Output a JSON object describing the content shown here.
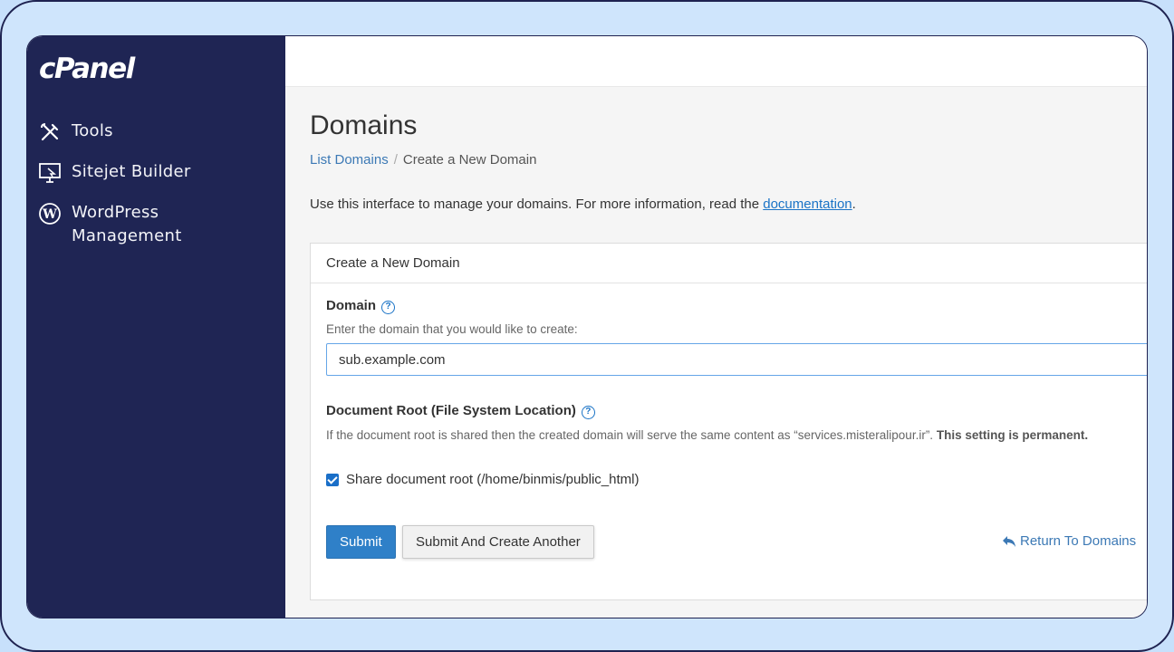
{
  "sidebar": {
    "logo": "cPanel",
    "items": [
      {
        "label": "Tools",
        "icon": "tools-icon"
      },
      {
        "label": "Sitejet Builder",
        "icon": "sitejet-icon"
      },
      {
        "label": "WordPress Management",
        "icon": "wordpress-icon"
      }
    ]
  },
  "main": {
    "title": "Domains",
    "breadcrumb": {
      "link": "List Domains",
      "separator": "/",
      "current": "Create a New Domain"
    },
    "intro": {
      "text": "Use this interface to manage your domains. For more information, read the ",
      "link": "documentation",
      "suffix": "."
    }
  },
  "panel": {
    "heading": "Create a New Domain",
    "domain": {
      "label": "Domain",
      "hint": "Enter the domain that you would like to create:",
      "value": "sub.example.com"
    },
    "docroot": {
      "label": "Document Root (File System Location)",
      "hint": "If the document root is shared then the created domain will serve the same content as “services.misteralipour.ir”. ",
      "hint_bold": "This setting is permanent.",
      "checkbox_label": "Share document root (/home/binmis/public_html)",
      "checked": true
    },
    "buttons": {
      "submit": "Submit",
      "submit_another": "Submit And Create Another",
      "return": "Return To Domains"
    }
  },
  "colors": {
    "sidebar_bg": "#1f2554",
    "accent": "#2f80c8",
    "link": "#3c79b5",
    "page_border": "#cfe5fc"
  }
}
